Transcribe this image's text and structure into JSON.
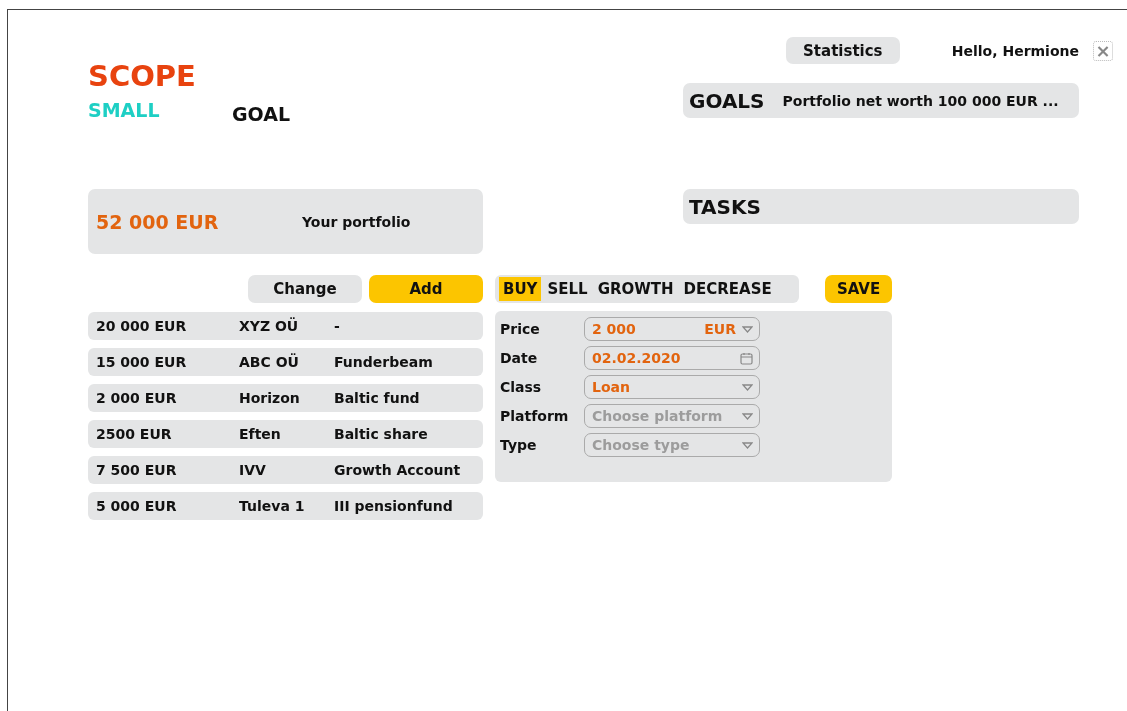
{
  "logo": {
    "title": "SCOPE",
    "words": [
      {
        "text": "SMALL",
        "accent": true
      },
      {
        "text": "GOAL",
        "accent": false
      }
    ]
  },
  "header": {
    "statistics_button": "Statistics",
    "greeting": "Hello, Hermione",
    "close": "×"
  },
  "goals": {
    "title": "GOALS",
    "text": "Portfolio net worth 100 000 EUR ..."
  },
  "tasks": {
    "title": "TASKS"
  },
  "portfolio": {
    "total": "52 000 EUR",
    "label": "Your portfolio"
  },
  "holding_actions": [
    {
      "label": "Change",
      "primary": false
    },
    {
      "label": "Add",
      "primary": true
    }
  ],
  "holdings": [
    {
      "amount": "20 000 EUR",
      "name": "XYZ OÜ",
      "platform": "-"
    },
    {
      "amount": "15 000 EUR",
      "name": "ABC OÜ",
      "platform": "Funderbeam"
    },
    {
      "amount": "2 000 EUR",
      "name": "Horizon",
      "platform": "Baltic fund"
    },
    {
      "amount": "2500 EUR",
      "name": "Eften",
      "platform": "Baltic share"
    },
    {
      "amount": "7 500 EUR",
      "name": "IVV",
      "platform": "Growth Account"
    },
    {
      "amount": "5 000 EUR",
      "name": "Tuleva 1",
      "platform": "III pensionfund"
    }
  ],
  "transaction_tabs": [
    {
      "label": "BUY",
      "selected": true
    },
    {
      "label": "SELL",
      "selected": false
    },
    {
      "label": "GROWTH",
      "selected": false
    },
    {
      "label": "DECREASE",
      "selected": false
    }
  ],
  "save_button": "SAVE",
  "form": [
    {
      "label": "Price",
      "kind": "currency",
      "value": "2 000",
      "unit": "EUR"
    },
    {
      "label": "Date",
      "kind": "date",
      "value": "02.02.2020"
    },
    {
      "label": "Class",
      "kind": "select",
      "value": "Loan"
    },
    {
      "label": "Platform",
      "kind": "select",
      "placeholder": "Choose platform"
    },
    {
      "label": "Type",
      "kind": "select",
      "placeholder": "Choose type"
    }
  ]
}
